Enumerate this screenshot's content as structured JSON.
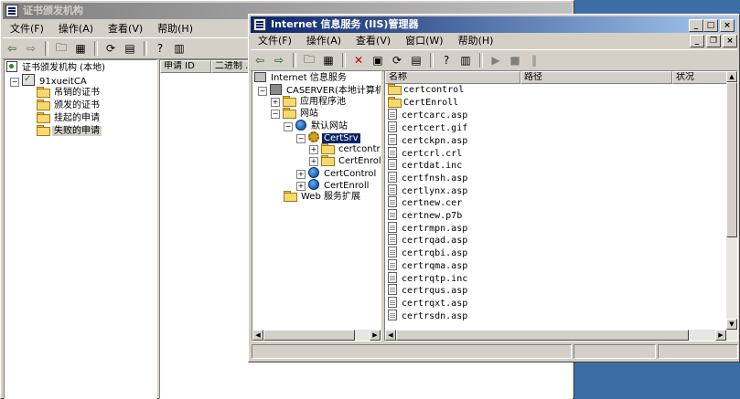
{
  "ca_window": {
    "title": "证书颁发机构",
    "menu": [
      "文件(F)",
      "操作(A)",
      "查看(V)",
      "帮助(H)"
    ],
    "tree": {
      "root": "证书颁发机构 (本地)",
      "ca_name": "91xueitCA",
      "folders": [
        "吊销的证书",
        "颁发的证书",
        "挂起的申请",
        "失败的申请"
      ]
    },
    "columns": [
      "申请 ID",
      "二进制 ..."
    ]
  },
  "iis_window": {
    "title": "Internet 信息服务 (IIS)管理器",
    "menu": [
      "文件(F)",
      "操作(A)",
      "查看(V)",
      "窗口(W)",
      "帮助(H)"
    ],
    "tree": {
      "root": "Internet 信息服务",
      "server": "CASERVER(本地计算机)",
      "app_pools": "应用程序池",
      "websites": "网站",
      "default_site": "默认网站",
      "certsrv": "CertSrv",
      "certcontrol_sub": "certcontr",
      "certenroll_sub": "CertEnrol",
      "certcontrol": "CertControl",
      "certenroll": "CertEnroll",
      "web_ext": "Web 服务扩展"
    },
    "columns": {
      "name": "名称",
      "path": "路径",
      "status": "状况"
    },
    "files": [
      {
        "name": "certcontrol",
        "type": "folder"
      },
      {
        "name": "CertEnroll",
        "type": "folder"
      },
      {
        "name": "certcarc.asp",
        "type": "file"
      },
      {
        "name": "certcert.gif",
        "type": "file"
      },
      {
        "name": "certckpn.asp",
        "type": "file"
      },
      {
        "name": "certcrl.crl",
        "type": "file"
      },
      {
        "name": "certdat.inc",
        "type": "file"
      },
      {
        "name": "certfnsh.asp",
        "type": "file"
      },
      {
        "name": "certlynx.asp",
        "type": "file"
      },
      {
        "name": "certnew.cer",
        "type": "file"
      },
      {
        "name": "certnew.p7b",
        "type": "file"
      },
      {
        "name": "certrmpn.asp",
        "type": "file"
      },
      {
        "name": "certrqad.asp",
        "type": "file"
      },
      {
        "name": "certrqbi.asp",
        "type": "file"
      },
      {
        "name": "certrqma.asp",
        "type": "file"
      },
      {
        "name": "certrqtp.inc",
        "type": "file"
      },
      {
        "name": "certrqus.asp",
        "type": "file"
      },
      {
        "name": "certrqxt.asp",
        "type": "file"
      },
      {
        "name": "certrsdn.asp",
        "type": "file"
      }
    ]
  }
}
